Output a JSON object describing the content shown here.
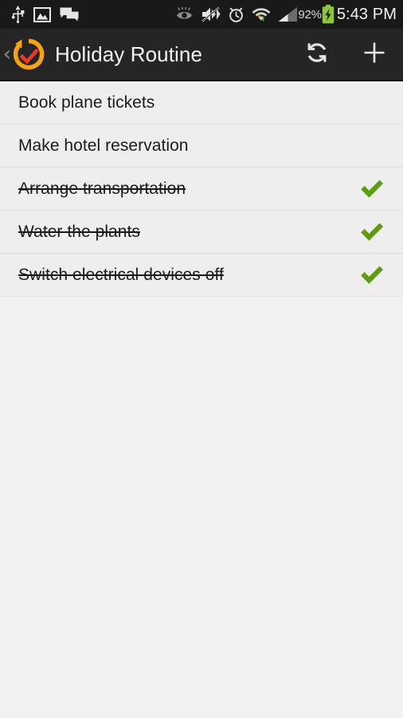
{
  "status_bar": {
    "left_icons": [
      {
        "name": "usb-icon",
        "label": "USB connected"
      },
      {
        "name": "image-icon",
        "label": "Screenshot captured"
      },
      {
        "name": "chat-bubbles-icon",
        "label": "New messages"
      }
    ],
    "right_icons": [
      {
        "name": "smart-stay-eye-icon",
        "label": "Smart stay"
      },
      {
        "name": "mute-vibrate-icon",
        "label": "Sound muted"
      },
      {
        "name": "alarm-clock-icon",
        "label": "Alarm set"
      },
      {
        "name": "wifi-data-transfer-icon",
        "label": "Wi-Fi"
      },
      {
        "name": "cellular-signal-icon",
        "label": "Signal"
      }
    ],
    "battery_percent": "92%",
    "battery_state": "charging",
    "clock": "5:43 PM",
    "background_color": "#191919",
    "text_color": "#f2f2f2"
  },
  "action_bar": {
    "up_chevron": "‹",
    "app_icon_name": "orange-circular-arrow-red-check-logo",
    "title": "Holiday Routine",
    "background_color": "#252525",
    "actions": [
      {
        "name": "sync-refresh-button",
        "label": "Refresh"
      },
      {
        "name": "add-task-button",
        "label": "Add"
      }
    ]
  },
  "task_list": {
    "row_background": "#eeeeee",
    "divider_color": "#e2e2e2",
    "check_color": "#5f9a14",
    "items": [
      {
        "label": "Book plane tickets",
        "done": false
      },
      {
        "label": "Make hotel reservation",
        "done": false
      },
      {
        "label": "Arrange transportation",
        "done": true
      },
      {
        "label": "Water the plants",
        "done": true
      },
      {
        "label": "Switch electrical devices off",
        "done": true
      }
    ]
  },
  "empty_area": {
    "background_color": "#f1f1f1"
  }
}
